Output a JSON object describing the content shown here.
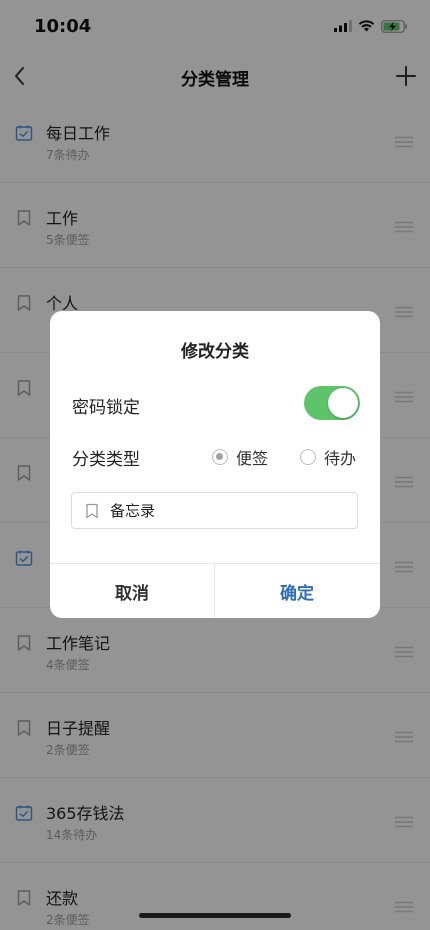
{
  "status_bar": {
    "time": "10:04"
  },
  "nav": {
    "title": "分类管理"
  },
  "categories": [
    {
      "title": "每日工作",
      "subtitle": "7条待办",
      "kind": "todo"
    },
    {
      "title": "工作",
      "subtitle": "5条便签",
      "kind": "note"
    },
    {
      "title": "个人",
      "subtitle": "",
      "kind": "note"
    },
    {
      "title": "",
      "subtitle": "",
      "kind": "note"
    },
    {
      "title": "",
      "subtitle": "",
      "kind": "note"
    },
    {
      "title": "",
      "subtitle": "",
      "kind": "todo"
    },
    {
      "title": "工作笔记",
      "subtitle": "4条便签",
      "kind": "note"
    },
    {
      "title": "日子提醒",
      "subtitle": "2条便签",
      "kind": "note"
    },
    {
      "title": "365存钱法",
      "subtitle": "14条待办",
      "kind": "todo"
    },
    {
      "title": "还款",
      "subtitle": "2条便签",
      "kind": "note"
    }
  ],
  "dialog": {
    "title": "修改分类",
    "password_lock_label": "密码锁定",
    "password_lock_on": true,
    "type_label": "分类类型",
    "type_options": [
      "便签",
      "待办"
    ],
    "type_selected": "便签",
    "name_value": "备忘录",
    "cancel_label": "取消",
    "confirm_label": "确定"
  },
  "colors": {
    "accent_blue": "#2f6eb3",
    "todo_icon": "#4a90d9",
    "toggle_on": "#5ec46b",
    "battery_charging": "#5ec46b"
  }
}
